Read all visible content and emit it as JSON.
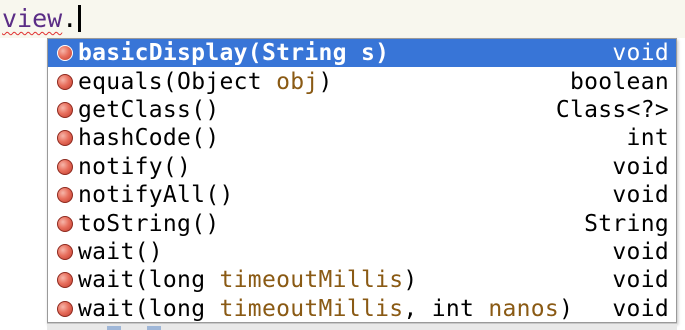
{
  "editor": {
    "identifier": "view",
    "dot": "."
  },
  "completion_popup": {
    "items": [
      {
        "name": "basicDisplay",
        "open": "(",
        "params": [
          {
            "type": "String ",
            "name": "s"
          }
        ],
        "close": ")",
        "return_type": "void",
        "selected": true
      },
      {
        "name": "equals",
        "open": "(",
        "params": [
          {
            "type": "Object ",
            "name": "obj"
          }
        ],
        "close": ")",
        "return_type": "boolean",
        "selected": false
      },
      {
        "name": "getClass",
        "open": "(",
        "params": [],
        "close": ")",
        "return_type": "Class<?>",
        "selected": false
      },
      {
        "name": "hashCode",
        "open": "(",
        "params": [],
        "close": ")",
        "return_type": "int",
        "selected": false
      },
      {
        "name": "notify",
        "open": "(",
        "params": [],
        "close": ")",
        "return_type": "void",
        "selected": false
      },
      {
        "name": "notifyAll",
        "open": "(",
        "params": [],
        "close": ")",
        "return_type": "void",
        "selected": false
      },
      {
        "name": "toString",
        "open": "(",
        "params": [],
        "close": ")",
        "return_type": "String",
        "selected": false
      },
      {
        "name": "wait",
        "open": "(",
        "params": [],
        "close": ")",
        "return_type": "void",
        "selected": false
      },
      {
        "name": "wait",
        "open": "(",
        "params": [
          {
            "type": "long ",
            "name": "timeoutMillis"
          }
        ],
        "close": ")",
        "return_type": "void",
        "selected": false
      },
      {
        "name": "wait",
        "open": "(",
        "params": [
          {
            "type": "long ",
            "name": "timeoutMillis"
          },
          {
            "type": "int ",
            "name": "nanos"
          }
        ],
        "close": ")",
        "return_type": "void",
        "selected": false
      }
    ],
    "icon": "public-method-icon",
    "colors": {
      "selection": "#3875d7",
      "param_name": "#8a5a14",
      "method_icon": "#e8705e"
    }
  }
}
